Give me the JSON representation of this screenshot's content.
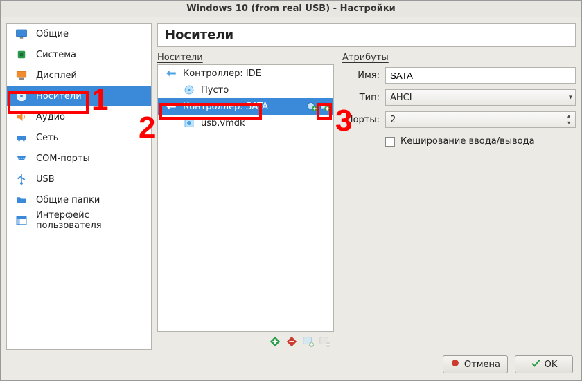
{
  "window": {
    "title": "Windows 10 (from real USB) - Настройки"
  },
  "sidebar": {
    "items": [
      {
        "label": "Общие"
      },
      {
        "label": "Система"
      },
      {
        "label": "Дисплей"
      },
      {
        "label": "Носители"
      },
      {
        "label": "Аудио"
      },
      {
        "label": "Сеть"
      },
      {
        "label": "COM-порты"
      },
      {
        "label": "USB"
      },
      {
        "label": "Общие папки"
      },
      {
        "label": "Интерфейс пользователя"
      }
    ]
  },
  "main": {
    "heading": "Носители",
    "storage_group": "Носители",
    "attrs_group": "Атрибуты",
    "tree": {
      "ide": {
        "label": "Контроллер: IDE",
        "child": "Пусто"
      },
      "sata": {
        "label": "Контроллер: SATA",
        "child": "usb.vmdk"
      }
    },
    "attrs": {
      "name_label": "Имя:",
      "name_value": "SATA",
      "type_label": "Тип:",
      "type_value": "AHCI",
      "ports_label": "Порты:",
      "ports_value": "2",
      "cache_label": "Кеширование ввода/вывода"
    }
  },
  "buttons": {
    "cancel": "Отмена",
    "ok_prefix": "O",
    "ok_suffix": "K"
  },
  "annotations": {
    "n1": "1",
    "n2": "2",
    "n3": "3"
  }
}
